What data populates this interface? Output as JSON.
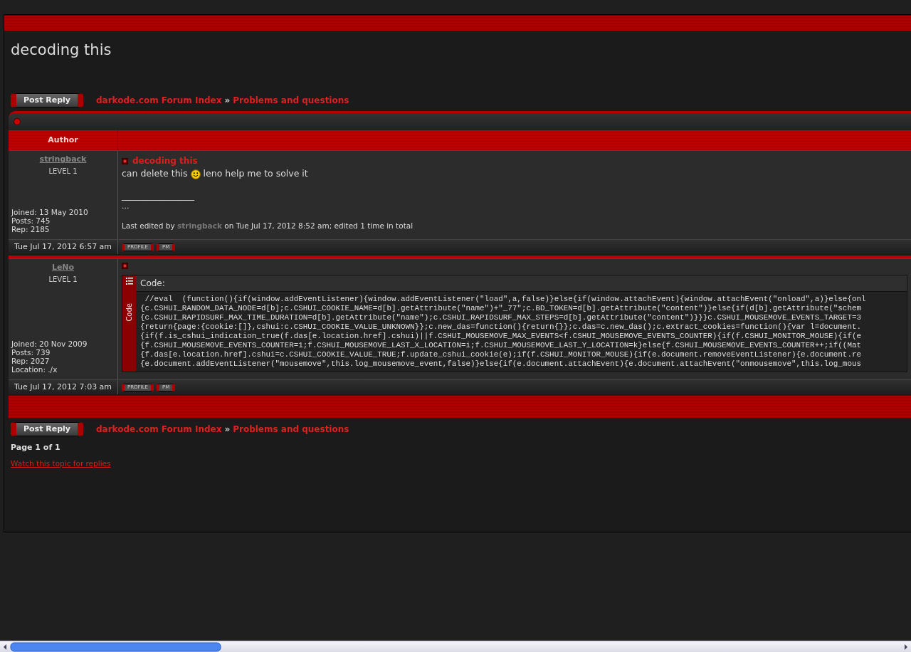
{
  "topic_title": "decoding this",
  "nav_top": {
    "button": "Post Reply",
    "breadcrumb": [
      "darkode.com Forum Index",
      "Problems and questions"
    ],
    "separator": "»"
  },
  "table": {
    "columns": [
      "Author"
    ],
    "posts": [
      {
        "author": "stringback",
        "rank": "LEVEL 1",
        "details": [
          "Joined: 13 May 2010",
          "Posts: 745",
          "Rep: 2185"
        ],
        "subject": "decoding this",
        "body": [
          {
            "kind": "text",
            "text": "can delete this"
          },
          {
            "kind": "smiley"
          },
          {
            "kind": "text",
            "text": "leno help me to solve it"
          }
        ],
        "signature_rule": "_________________",
        "signature": "...",
        "edit_note": {
          "prefix": "Last edited by",
          "user": "stringback",
          "suffix": "on Tue Jul 17, 2012 8:52 am; edited 1 time in total"
        },
        "date": "Tue Jul 17, 2012 6:57 am",
        "buttons": [
          "PROFILE",
          "PM"
        ]
      },
      {
        "author": "LeNo",
        "rank": "LEVEL 1",
        "details": [
          "Joined: 20 Nov 2009",
          "Posts: 739",
          "Rep: 2027",
          "Location: ./x"
        ],
        "body": [
          {
            "kind": "code",
            "title": "Code:",
            "side_label": "Code",
            "lines": [
              " //eval  (function(){if(window.addEventListener){window.addEventListener(\"load\",a,false)}else{if(window.attachEvent){window.attachEvent(\"onload\",a)}else{onl",
              "{c.CSHUI_RANDOM_DATA_NODE=d[b];c.CSHUI_COOKIE_NAME=d[b].getAttribute(\"name\")+\"_77\";c.BD_TOKEN=d[b].getAttribute(\"content\")}else{if(d[b].getAttribute(\"schem",
              "{c.CSHUI_RAPIDSURF_MAX_TIME_DURATION=d[b].getAttribute(\"name\");c.CSHUI_RAPIDSURF_MAX_STEPS=d[b].getAttribute(\"content\")}}}c.CSHUI_MOUSEMOVE_EVENTS_TARGET=3",
              "{return{page:{cookie:[]},cshui:c.CSHUI_COOKIE_VALUE_UNKNOWN}};c.new_das=function(){return{}};c.das=c.new_das();c.extract_cookies=function(){var l=document.",
              "{if(f.is_cshui_indication_true(f.das[e.location.href].cshui)||f.CSHUI_MOUSEMOVE_MAX_EVENTS<f.CSHUI_MOUSEMOVE_EVENTS_COUNTER){if(f.CSHUI_MONITOR_MOUSE){if(e",
              "{f.CSHUI_MOUSEMOVE_EVENTS_COUNTER=1;f.CSHUI_MOUSEMOVE_LAST_X_LOCATION=i;f.CSHUI_MOUSEMOVE_LAST_Y_LOCATION=k}else{f.CSHUI_MOUSEMOVE_EVENTS_COUNTER++;if((Mat",
              "{f.das[e.location.href].cshui=c.CSHUI_COOKIE_VALUE_TRUE;f.update_cshui_cookie(e);if(f.CSHUI_MONITOR_MOUSE){if(e.document.removeEventListener){e.document.re",
              "{e.document.addEventListener(\"mousemove\",this.log_mousemove_event,false)}else{if(e.document.attachEvent){e.document.attachEvent(\"onmousemove\",this.log_mous"
            ]
          }
        ],
        "date": "Tue Jul 17, 2012 7:03 am",
        "buttons": [
          "PROFILE",
          "PM"
        ]
      }
    ]
  },
  "nav_bottom": {
    "button": "Post Reply",
    "breadcrumb": [
      "darkode.com Forum Index",
      "Problems and questions"
    ],
    "separator": "»"
  },
  "pagination": "Page 1 of 1",
  "watch_link": "Watch this topic for replies"
}
